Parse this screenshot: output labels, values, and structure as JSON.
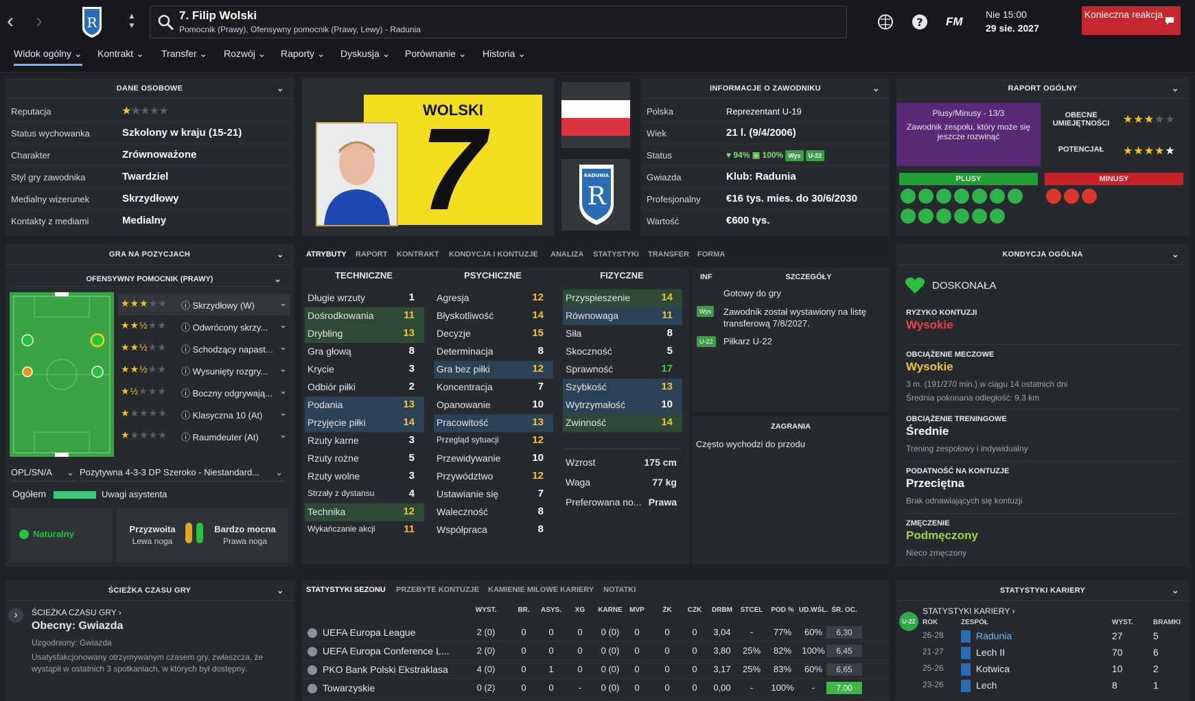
{
  "header": {
    "player_title": "7. Filip Wolski",
    "player_subtitle": "Pomocnik (Prawy), Ofensywny pomocnik (Prawy, Lewy) - Radunia",
    "date_line1": "Nie 15:00",
    "date_line2": "29 sie. 2027",
    "fm_label": "FM",
    "action_button": "Konieczna reakcja"
  },
  "tabs": [
    "Widok ogólny",
    "Kontrakt",
    "Transfer",
    "Rozwój",
    "Raporty",
    "Dyskusja",
    "Porównanie",
    "Historia"
  ],
  "personal": {
    "title": "DANE OSOBOWE",
    "rows": [
      {
        "label": "Reputacja",
        "value": ""
      },
      {
        "label": "Status wychowanka",
        "value": "Szkolony w kraju (15-21)"
      },
      {
        "label": "Charakter",
        "value": "Zrównoważone"
      },
      {
        "label": "Styl gry zawodnika",
        "value": "Twardziel"
      },
      {
        "label": "Medialny wizerunek",
        "value": "Skrzydłowy"
      },
      {
        "label": "Kontakty z mediami",
        "value": "Medialny"
      }
    ],
    "reputation_stars": 1
  },
  "shirt": {
    "name": "WOLSKI",
    "number": "7"
  },
  "club_badge_text": "RADUNIA",
  "info": {
    "title": "INFORMACJE O ZAWODNIKU",
    "rows": [
      {
        "label": "Polska",
        "value": "Reprezentant U-19"
      },
      {
        "label": "Wiek",
        "value": "21 l. (9/4/2006)"
      },
      {
        "label": "Status",
        "value": ""
      },
      {
        "label": "Gwiazda",
        "value": "Klub: Radunia"
      },
      {
        "label": "Profesjonalny",
        "value": "€16 tys. mies. do 30/6/2030"
      },
      {
        "label": "Wartość",
        "value": "€600 tys."
      }
    ],
    "status_condition": "94%",
    "status_sharpness": "100%",
    "status_chip1": "Wys",
    "status_chip2": "U-22"
  },
  "report": {
    "title": "RAPORT OGÓLNY",
    "plusminus": "Plusy/Minusy - 13/3",
    "desc": "Zawodnik zespołu, który może się jeszcze rozwinąć",
    "current_label": "OBECNE UMIEJĘTNOŚCI",
    "potential_label": "POTENCJAŁ",
    "current_stars": 3,
    "potential_stars": 5,
    "plus_label": "PLUSY",
    "minus_label": "MINUSY",
    "plus_count": 13,
    "minus_count": 3
  },
  "positions": {
    "title": "GRA NA POZYCJACH",
    "role_header": "OFENSYWNY POMOCNIK (PRAWY)",
    "roles": [
      {
        "stars": 3.0,
        "name": "Skrzydłowy (W)"
      },
      {
        "stars": 2.5,
        "name": "Odwrócony skrzy..."
      },
      {
        "stars": 2.5,
        "name": "Schodzący napast..."
      },
      {
        "stars": 2.5,
        "name": "Wysunięty rozgry..."
      },
      {
        "stars": 1.5,
        "name": "Boczny odgrywają..."
      },
      {
        "stars": 1.0,
        "name": "Klasyczna 10 (At)"
      },
      {
        "stars": 1.0,
        "name": "Raumdeuter (At)"
      }
    ],
    "dropdown1": "OPL/SN/A",
    "dropdown2": "Pozytywna 4-3-3 DP Szeroko - Niestandard...",
    "overall_label": "Ogółem",
    "assistant_label": "Uwagi asystenta",
    "natural_label": "Naturalny",
    "left_foot_label": "Przyzwoita",
    "left_foot_sub": "Lewa noga",
    "right_foot_label": "Bardzo mocna",
    "right_foot_sub": "Prawa noga"
  },
  "attr_tabs": [
    "ATRYBUTY",
    "RAPORT",
    "KONTRAKT",
    "KONDYCJA I KONTUZJE",
    "ANALIZA",
    "STATYSTYKI",
    "TRANSFER",
    "FORMA"
  ],
  "technical": {
    "title": "TECHNICZNE",
    "items": [
      {
        "name": "Długie wrzuty",
        "value": "1"
      },
      {
        "name": "Dośrodkowania",
        "value": "11"
      },
      {
        "name": "Drybling",
        "value": "13"
      },
      {
        "name": "Gra głową",
        "value": "8"
      },
      {
        "name": "Krycie",
        "value": "3"
      },
      {
        "name": "Odbiór piłki",
        "value": "2"
      },
      {
        "name": "Podania",
        "value": "13"
      },
      {
        "name": "Przyjęcie piłki",
        "value": "14"
      },
      {
        "name": "Rzuty karne",
        "value": "3"
      },
      {
        "name": "Rzuty rożne",
        "value": "5"
      },
      {
        "name": "Rzuty wolne",
        "value": "3"
      },
      {
        "name": "Strzały z dystansu",
        "value": "4"
      },
      {
        "name": "Technika",
        "value": "12"
      },
      {
        "name": "Wykańczanie akcji",
        "value": "11"
      }
    ]
  },
  "mental": {
    "title": "PSYCHICZNE",
    "items": [
      {
        "name": "Agresja",
        "value": "12"
      },
      {
        "name": "Błyskotliwość",
        "value": "14"
      },
      {
        "name": "Decyzje",
        "value": "15"
      },
      {
        "name": "Determinacja",
        "value": "8"
      },
      {
        "name": "Gra bez piłki",
        "value": "12"
      },
      {
        "name": "Koncentracja",
        "value": "7"
      },
      {
        "name": "Opanowanie",
        "value": "10"
      },
      {
        "name": "Pracowitość",
        "value": "13"
      },
      {
        "name": "Przegląd sytuacji",
        "value": "12"
      },
      {
        "name": "Przewidywanie",
        "value": "10"
      },
      {
        "name": "Przywództwo",
        "value": "12"
      },
      {
        "name": "Ustawianie się",
        "value": "7"
      },
      {
        "name": "Waleczność",
        "value": "8"
      },
      {
        "name": "Współpraca",
        "value": "8"
      }
    ]
  },
  "physical": {
    "title": "FIZYCZNE",
    "items": [
      {
        "name": "Przyspieszenie",
        "value": "14"
      },
      {
        "name": "Równowaga",
        "value": "11"
      },
      {
        "name": "Siła",
        "value": "8"
      },
      {
        "name": "Skoczność",
        "value": "5"
      },
      {
        "name": "Sprawność",
        "value": "17"
      },
      {
        "name": "Szybkość",
        "value": "13"
      },
      {
        "name": "Wytrzymałość",
        "value": "10"
      },
      {
        "name": "Zwinność",
        "value": "14"
      }
    ],
    "extra": [
      {
        "name": "Wzrost",
        "value": "175 cm"
      },
      {
        "name": "Waga",
        "value": "77 kg"
      },
      {
        "name": "Preferowana no...",
        "value": "Prawa"
      }
    ]
  },
  "details": {
    "inf": "INF",
    "title": "SZCZEGÓŁY",
    "rows": [
      {
        "chip": "",
        "text": "Gotowy do gry"
      },
      {
        "chip": "Wys",
        "text": "Zawodnik został wystawiony na listę transferową 7/8/2027."
      },
      {
        "chip": "U-22",
        "text": "Piłkarz U-22"
      }
    ],
    "play_title": "ZAGRANIA",
    "play_text": "Często wychodzi do przodu"
  },
  "fitness": {
    "title": "KONDYCJA OGÓLNA",
    "state": "DOSKONAŁA",
    "blocks": [
      {
        "title": "RYZYKO KONTUZJI",
        "value": "Wysokie",
        "color": "#e8434a",
        "sub": "",
        "sub2": ""
      },
      {
        "title": "OBCIĄŻENIE MECZOWE",
        "value": "Wysokie",
        "color": "#f2c230",
        "sub": "3 m. (191/270 min.) w ciągu 14 ostatnich dni",
        "sub2": "Średnia pokonana odległość: 9,3 km"
      },
      {
        "title": "OBCIĄŻENIE TRENINGOWE",
        "value": "Średnie",
        "color": "#ffffff",
        "sub": "Trening zespołowy i indywidualny",
        "sub2": ""
      },
      {
        "title": "PODATNOŚĆ NA KONTUZJE",
        "value": "Przeciętna",
        "color": "#ffffff",
        "sub": "Brak odnawiających się kontuzji",
        "sub2": ""
      },
      {
        "title": "ZMĘCZENIE",
        "value": "Podmęczony",
        "color": "#9bd83a",
        "sub": "Nieco zmęczony",
        "sub2": ""
      }
    ]
  },
  "playtime": {
    "title": "ŚCIEŻKA CZASU GRY",
    "link": "ŚCIEŻKA CZASU GRY ›",
    "current": "Obecny: Gwiazda",
    "agreed": "Uzgodniony: Gwiazda",
    "desc": "Usatysfakcjonowany otrzymywanym czasem gry, zwłaszcza, że wystąpił w ostatnich 3 spotkaniach, w których był dostępny."
  },
  "season": {
    "tabs": [
      "STATYSTYKI SEZONU",
      "PRZEBYTE KONTUZJE",
      "KAMIENIE MILOWE KARIERY",
      "NOTATKI"
    ],
    "columns": [
      "WYST.",
      "BR.",
      "ASYS.",
      "XG",
      "KARNE",
      "MVP",
      "ŻK",
      "CZK",
      "DRBM",
      "STCEL",
      "POD %",
      "UD.WŚL.",
      "ŚR. OC."
    ],
    "rows": [
      {
        "comp": "UEFA Europa League",
        "vals": [
          "2 (0)",
          "0",
          "0",
          "0",
          "0 (0)",
          "0",
          "0",
          "0",
          "3,04",
          "-",
          "77%",
          "60%",
          "6,30"
        ]
      },
      {
        "comp": "UEFA Europa Conference L...",
        "vals": [
          "2 (0)",
          "0",
          "0",
          "0",
          "0 (0)",
          "0",
          "0",
          "0",
          "3,80",
          "25%",
          "82%",
          "100%",
          "6,45"
        ]
      },
      {
        "comp": "PKO Bank Polski Ekstraklasa",
        "vals": [
          "4 (0)",
          "0",
          "1",
          "0",
          "0 (0)",
          "0",
          "0",
          "0",
          "3,17",
          "25%",
          "83%",
          "60%",
          "6,65"
        ]
      },
      {
        "comp": "Towarzyskie",
        "vals": [
          "0 (2)",
          "0",
          "0",
          "-",
          "0 (0)",
          "0",
          "0",
          "0",
          "0,00",
          "-",
          "100%",
          "-",
          "7,00"
        ]
      }
    ]
  },
  "career": {
    "title": "STATYSTYKI KARIERY",
    "link": "STATYSTYKI KARIERY ›",
    "badge": "U-22",
    "cols": [
      "ROK",
      "ZESPÓŁ",
      "WYST.",
      "BRAMKI"
    ],
    "rows": [
      {
        "year": "26-28",
        "team": "Radunia",
        "apps": "27",
        "goals": "5"
      },
      {
        "year": "21-27",
        "team": "Lech II",
        "apps": "70",
        "goals": "6"
      },
      {
        "year": "25-26",
        "team": "Kotwica",
        "apps": "10",
        "goals": "2"
      },
      {
        "year": "23-26",
        "team": "Lech",
        "apps": "8",
        "goals": "1"
      }
    ]
  }
}
